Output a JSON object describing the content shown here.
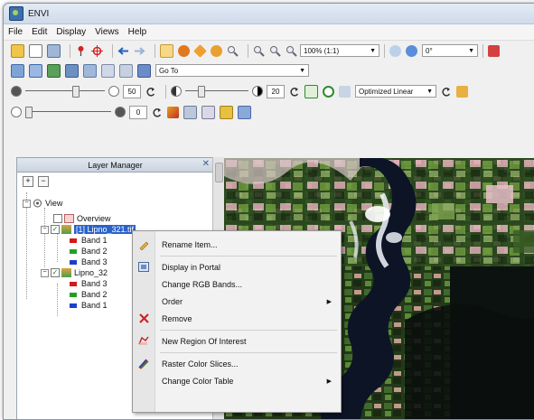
{
  "window": {
    "title": "ENVI"
  },
  "menu": [
    "File",
    "Edit",
    "Display",
    "Views",
    "Help"
  ],
  "toolbar": {
    "zoom_value": "100% (1:1)",
    "rotation_value": "0°",
    "goto_label": "Go To",
    "brightness_value": "50",
    "contrast_value": "20",
    "stretch_value": "Optimized Linear",
    "transparency_value": "0"
  },
  "layer_manager": {
    "title": "Layer Manager",
    "view_label": "View",
    "overview_label": "Overview",
    "layer1_label": "[1] Lipno_321.tif",
    "layer1_bands": [
      "Band 1",
      "Band 2",
      "Band 3"
    ],
    "layer2_label": "Lipno_32",
    "layer2_bands": [
      "Band 3",
      "Band 2",
      "Band 1"
    ]
  },
  "colors": {
    "band_red": "#d41a1a",
    "band_green": "#21a121",
    "band_blue": "#1f3fc8",
    "selection": "#2b62c8"
  },
  "context_menu": {
    "rename": "Rename Item...",
    "display_portal": "Display in Portal",
    "change_rgb": "Change RGB Bands...",
    "order": "Order",
    "remove": "Remove",
    "new_roi": "New Region Of Interest",
    "raster_slices": "Raster Color Slices...",
    "change_color_table": "Change Color Table"
  }
}
